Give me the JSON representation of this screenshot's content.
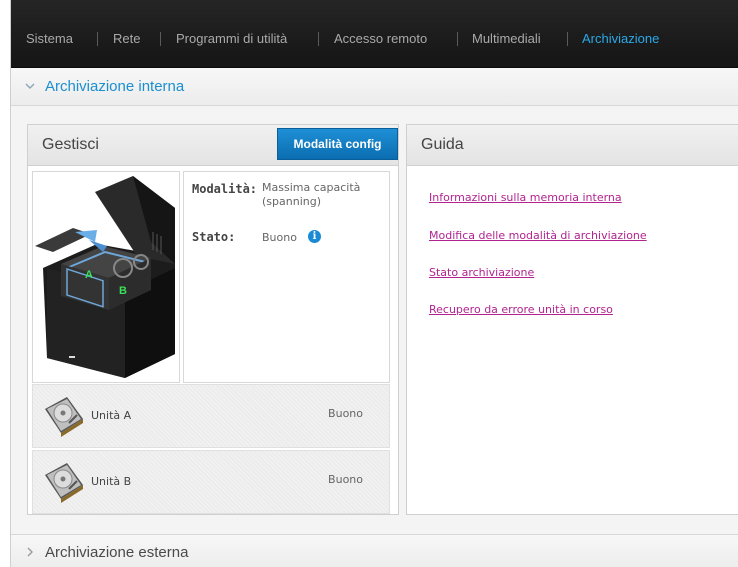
{
  "nav": {
    "items": [
      {
        "label": "Sistema",
        "active": false
      },
      {
        "label": "Rete",
        "active": false
      },
      {
        "label": "Programmi di utilità",
        "active": false
      },
      {
        "label": "Accesso remoto",
        "active": false
      },
      {
        "label": "Multimediali",
        "active": false
      },
      {
        "label": "Archiviazione",
        "active": true
      }
    ],
    "active_color": "#2aa8e6"
  },
  "sections": {
    "internal": {
      "title": "Archiviazione interna",
      "expanded": true,
      "chevron_icon": "chevron-down-icon"
    },
    "external": {
      "title": "Archiviazione esterna",
      "expanded": false,
      "chevron_icon": "chevron-right-icon"
    }
  },
  "manage": {
    "title": "Gestisci",
    "config_button": "Modalità config",
    "mode_label": "Modalità:",
    "mode_value": "Massima capacità (spanning)",
    "status_label": "Stato:",
    "status_value": "Buono",
    "device_labels": {
      "a": "A",
      "b": "B"
    },
    "drives": [
      {
        "name": "Unità A",
        "status": "Buono"
      },
      {
        "name": "Unità B",
        "status": "Buono"
      }
    ]
  },
  "guide": {
    "title": "Guida",
    "links": [
      "Informazioni sulla memoria interna",
      "Modifica delle modalità di archiviazione",
      "Stato archiviazione",
      "Recupero da errore unità in corso"
    ],
    "link_color": "#b2238f"
  }
}
